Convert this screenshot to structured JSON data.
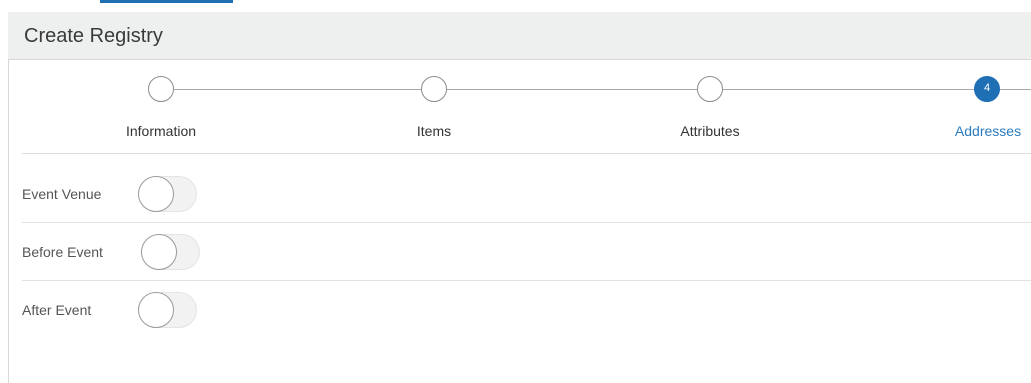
{
  "header": {
    "title": "Create Registry"
  },
  "train": {
    "steps": [
      {
        "label": "Information",
        "number": "",
        "state": "visited"
      },
      {
        "label": "Items",
        "number": "",
        "state": "visited"
      },
      {
        "label": "Attributes",
        "number": "",
        "state": "visited"
      },
      {
        "label": "Addresses",
        "number": "4",
        "state": "current"
      }
    ]
  },
  "form": {
    "rows": [
      {
        "label": "Event Venue",
        "enabled": false
      },
      {
        "label": "Before Event",
        "enabled": false
      },
      {
        "label": "After Event",
        "enabled": false
      }
    ]
  },
  "colors": {
    "accent": "#1f6fb5",
    "header_bg": "#eef0f0"
  }
}
